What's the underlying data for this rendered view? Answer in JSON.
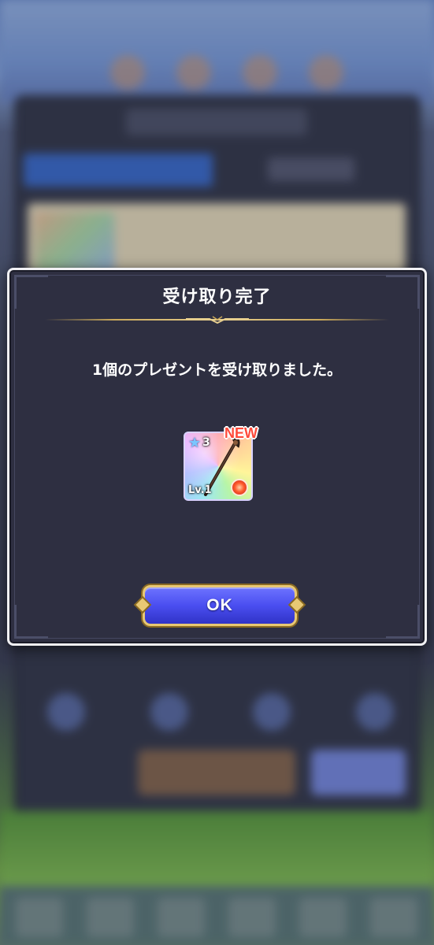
{
  "dialog": {
    "title": "受け取り完了",
    "message": "1個のプレゼントを受け取りました。",
    "item": {
      "rarity": "3",
      "level": "Lv.1",
      "badge": "NEW",
      "element_icon": "fire-element-icon",
      "icon": "staff-weapon-icon"
    },
    "ok_label": "OK"
  },
  "colors": {
    "dialog_bg": "#2e2f41",
    "dialog_border": "#f1f1f4",
    "gold_accent": "#c9a85a",
    "button_blue": "#4a4ef0",
    "new_badge": "#ff4a3a"
  }
}
